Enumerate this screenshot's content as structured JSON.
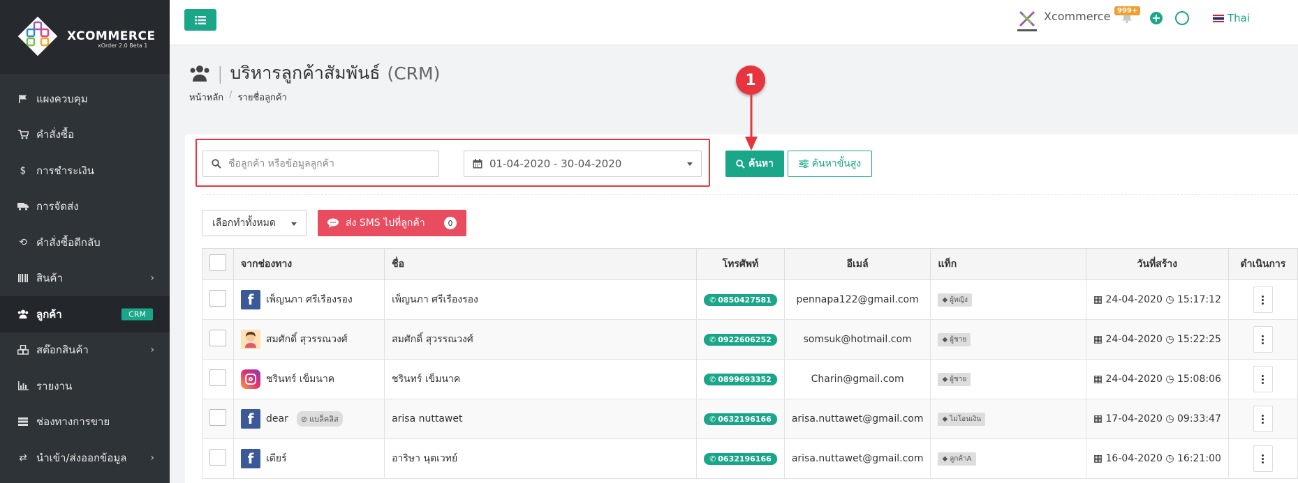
{
  "brand": {
    "name": "XCOMMERCE",
    "version": "xOrder 2.0 Beta 1"
  },
  "sidebar": {
    "items": [
      {
        "label": "แผงควบคุม",
        "icon": "flag-icon",
        "chevron": false
      },
      {
        "label": "คำสั่งซื้อ",
        "icon": "cart-icon",
        "chevron": false
      },
      {
        "label": "การชำระเงิน",
        "icon": "dollar-icon",
        "chevron": false
      },
      {
        "label": "การจัดส่ง",
        "icon": "truck-icon",
        "chevron": false
      },
      {
        "label": "คำสั่งซื้อตีกลับ",
        "icon": "undo-icon",
        "chevron": false
      },
      {
        "label": "สินค้า",
        "icon": "barcode-icon",
        "chevron": true
      },
      {
        "label": "ลูกค้า",
        "icon": "users-icon",
        "chevron": false,
        "badge": "CRM",
        "active": true
      },
      {
        "label": "สต๊อกสินค้า",
        "icon": "cubes-icon",
        "chevron": true
      },
      {
        "label": "รายงาน",
        "icon": "bar-chart-icon",
        "chevron": false
      },
      {
        "label": "ช่องทางการขาย",
        "icon": "list-icon",
        "chevron": false
      },
      {
        "label": "นำเข้า/ส่งออกข้อมูล",
        "icon": "exchange-icon",
        "chevron": true
      }
    ]
  },
  "topbar": {
    "app_name": "Xcommerce",
    "notification_count": "999+",
    "language": "Thai"
  },
  "page": {
    "title": "บริหารลูกค้าสัมพันธ์",
    "title_suffix": "(CRM)",
    "breadcrumb": [
      "หน้าหลัก",
      "รายชื่อลูกค้า"
    ]
  },
  "filters": {
    "search_placeholder": "ชื่อลูกค้า หรือข้อมูลลูกค้า",
    "date_range": "01-04-2020 - 30-04-2020",
    "search_button": "ค้นหา",
    "advanced_button": "ค้นหาขั้นสูง"
  },
  "callout": {
    "number": "1"
  },
  "actions": {
    "select_all": "เลือกทำทั้งหมด",
    "sms_button": "ส่ง SMS ไปที่ลูกค้า",
    "sms_count": "0"
  },
  "table": {
    "headers": [
      "จากช่องทาง",
      "ชื่อ",
      "โทรศัพท์",
      "อีเมล์",
      "แท็ก",
      "วันที่สร้าง",
      "ดำเนินการ"
    ],
    "rows": [
      {
        "source": "facebook",
        "source_name": "เพ็ญนภา ศรีเรืองรอง",
        "blacklist": "",
        "name": "เพ็ญนภา ศรีเรืองรอง",
        "phone": "0850427581",
        "email": "pennapa122@gmail.com",
        "tag": "ผู้หญิง",
        "date": "24-04-2020",
        "time": "15:17:12"
      },
      {
        "source": "line",
        "source_name": "สมศักดิ์ สุวรรณวงศ์",
        "blacklist": "",
        "name": "สมศักดิ์ สุวรรณวงศ์",
        "phone": "0922606252",
        "email": "somsuk@hotmail.com",
        "tag": "ผู้ชาย",
        "date": "24-04-2020",
        "time": "15:22:25"
      },
      {
        "source": "instagram",
        "source_name": "ชรินทร์ เข็มนาค",
        "blacklist": "",
        "name": "ชรินทร์ เข็มนาค",
        "phone": "0899693352",
        "email": "Charin@gmail.com",
        "tag": "ผู้ชาย",
        "date": "24-04-2020",
        "time": "15:08:06"
      },
      {
        "source": "facebook",
        "source_name": "dear",
        "blacklist": "แบล็คลิส",
        "name": "arisa nuttawet",
        "phone": "0632196166",
        "email": "arisa.nuttawet@gmail.com",
        "tag": "ไม่โอนเงิน",
        "date": "17-04-2020",
        "time": "09:33:47"
      },
      {
        "source": "facebook",
        "source_name": "เดียร์",
        "blacklist": "",
        "name": "อาริษา นุตเวทย์",
        "phone": "0632196166",
        "email": "arisa.nuttawet@gmail.com",
        "tag": "ลูกค้าA",
        "date": "16-04-2020",
        "time": "16:21:00"
      }
    ]
  },
  "colors": {
    "accent": "#1aa689",
    "sidebar": "#2e3338",
    "danger": "#e84c5e",
    "callout": "#e8343e"
  }
}
